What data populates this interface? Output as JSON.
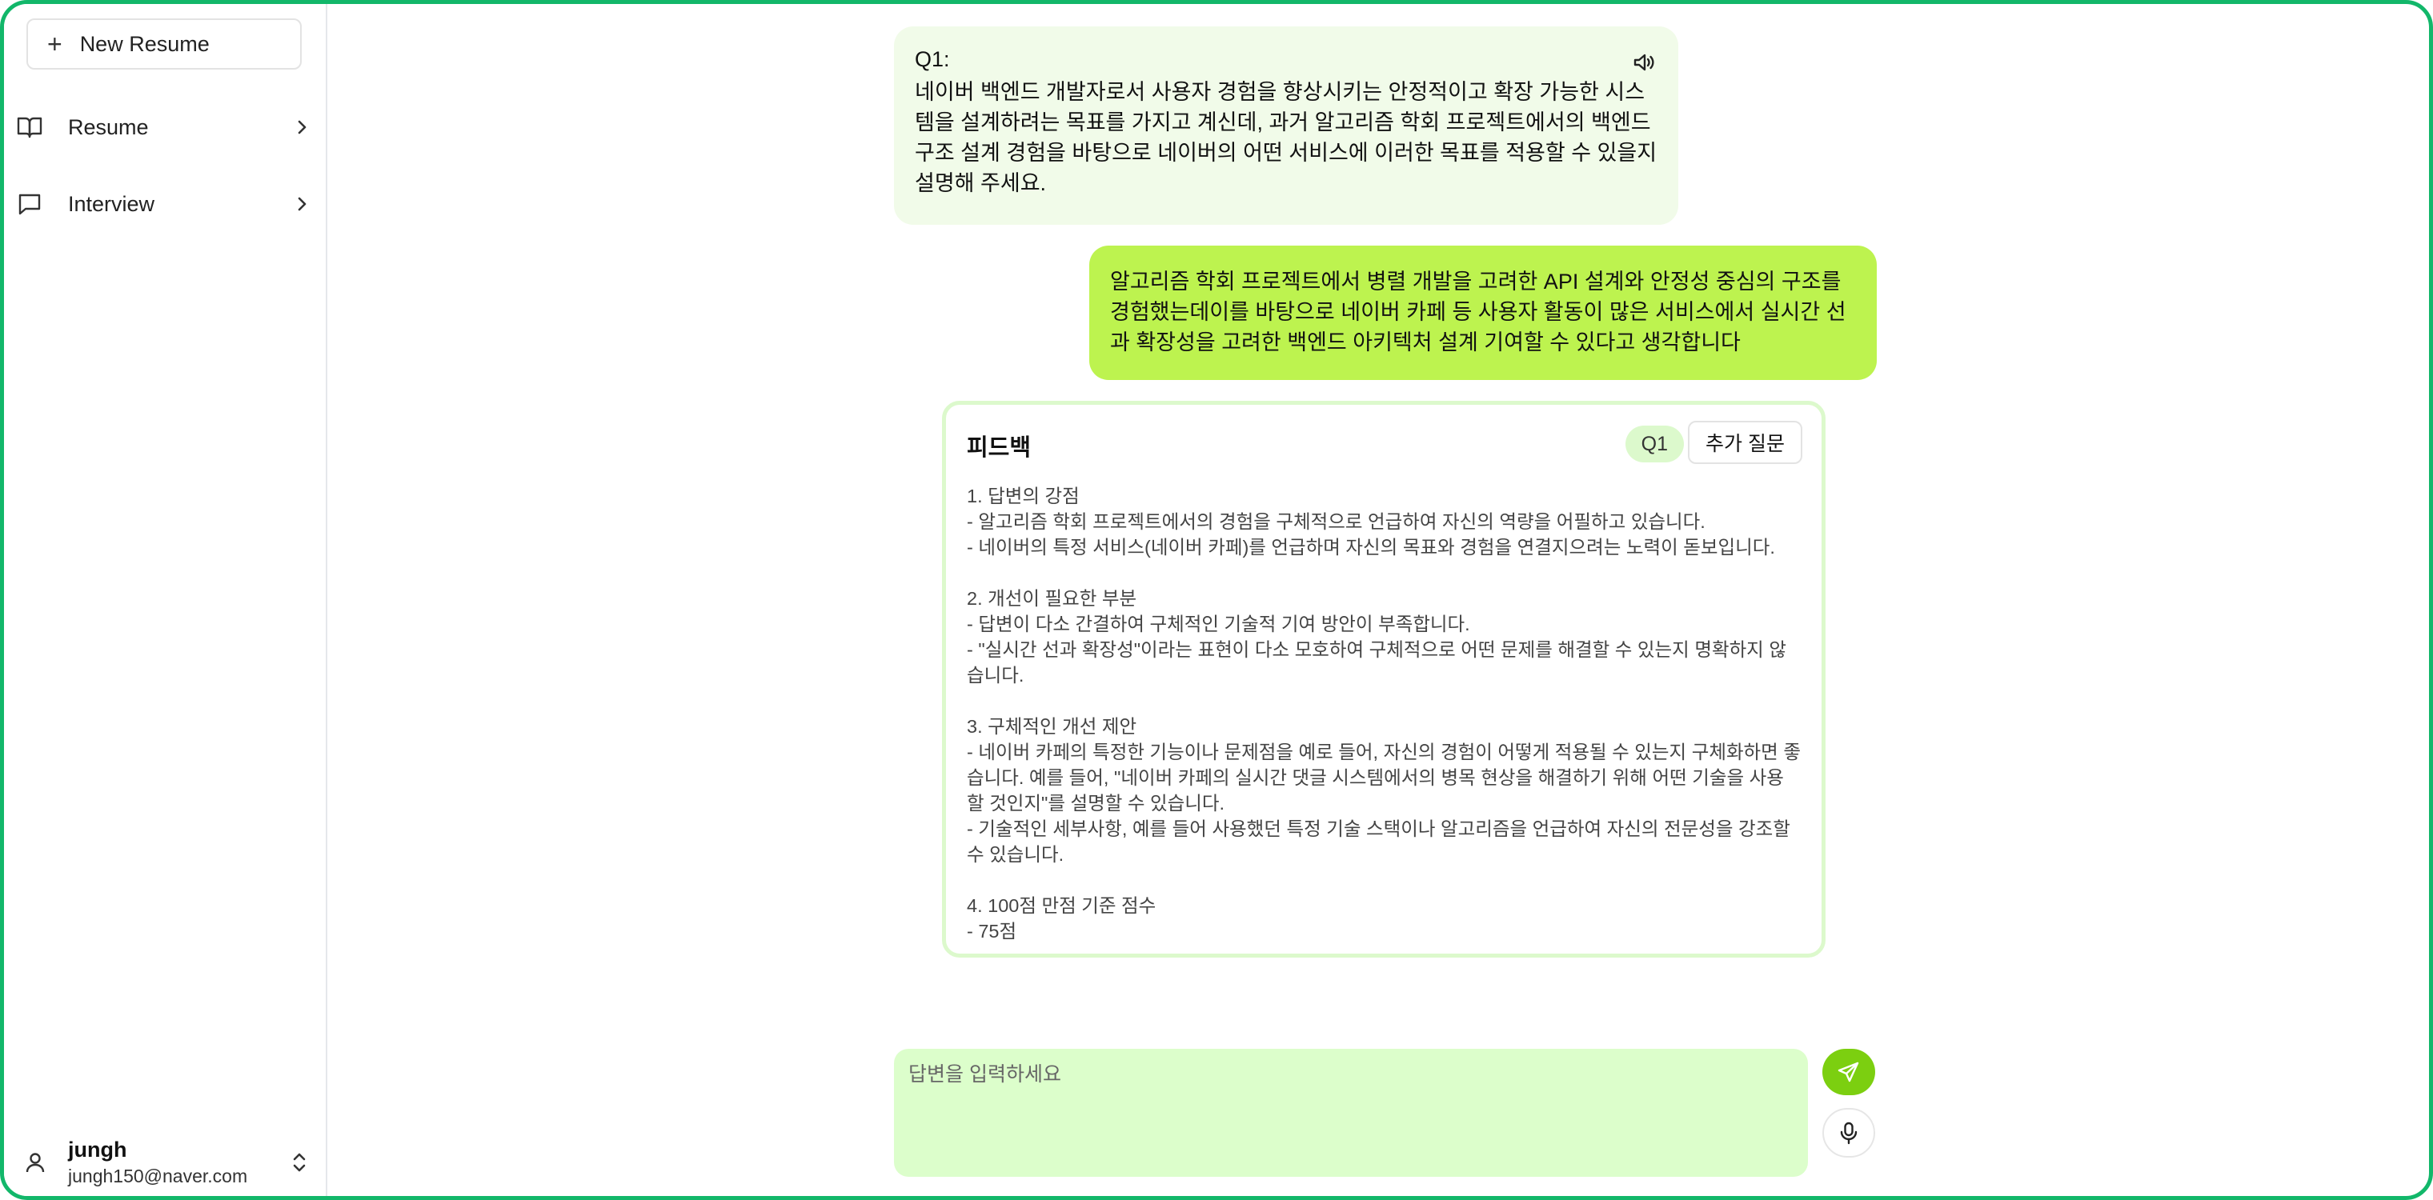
{
  "sidebar": {
    "new_resume_label": "New Resume",
    "items": [
      {
        "label": "Resume",
        "icon": "book-open-icon"
      },
      {
        "label": "Interview",
        "icon": "message-square-icon"
      }
    ],
    "user": {
      "name": "jungh",
      "email": "jungh150@naver.com"
    }
  },
  "chat": {
    "question": {
      "label": "Q1:",
      "text": "네이버 백엔드 개발자로서 사용자 경험을 향상시키는 안정적이고 확장 가능한 시스템을 설계하려는 목표를 가지고 계신데, 과거 알고리즘 학회 프로젝트에서의 백엔드 구조 설계 경험을 바탕으로 네이버의 어떤 서비스에 이러한 목표를 적용할 수 있을지 설명해 주세요."
    },
    "answer": {
      "text": "알고리즘 학회 프로젝트에서 병렬 개발을 고려한 API 설계와 안정성 중심의 구조를 경험했는데이를 바탕으로 네이버 카페 등 사용자 활동이 많은 서비스에서 실시간 선과 확장성을 고려한 백엔드 아키텍처 설계 기여할 수 있다고 생각합니다"
    },
    "feedback": {
      "title": "피드백",
      "badge": "Q1",
      "more_label": "추가 질문",
      "body": "1. 답변의 강점\n- 알고리즘 학회 프로젝트에서의 경험을 구체적으로 언급하여 자신의 역량을 어필하고 있습니다.\n- 네이버의 특정 서비스(네이버 카페)를 언급하며 자신의 목표와 경험을 연결지으려는 노력이 돋보입니다.\n\n2. 개선이 필요한 부분\n- 답변이 다소 간결하여 구체적인 기술적 기여 방안이 부족합니다.\n- \"실시간 선과 확장성\"이라는 표현이 다소 모호하여 구체적으로 어떤 문제를 해결할 수 있는지 명확하지 않습니다.\n\n3. 구체적인 개선 제안\n- 네이버 카페의 특정한 기능이나 문제점을 예로 들어, 자신의 경험이 어떻게 적용될 수 있는지 구체화하면 좋습니다. 예를 들어, \"네이버 카페의 실시간 댓글 시스템에서의 병목 현상을 해결하기 위해 어떤 기술을 사용할 것인지\"를 설명할 수 있습니다.\n- 기술적인 세부사항, 예를 들어 사용했던 특정 기술 스택이나 알고리즘을 언급하여 자신의 전문성을 강조할 수 있습니다.\n\n4. 100점 만점 기준 점수\n- 75점"
    },
    "input": {
      "placeholder": "답변을 입력하세요",
      "value": ""
    }
  },
  "colors": {
    "frame": "#12b76a",
    "question_bg": "#f1fbe9",
    "answer_bg": "#bdf34f",
    "feedback_border": "#dcf9cc",
    "input_bg": "#dcfecb",
    "send_bg": "#7ccf10"
  }
}
